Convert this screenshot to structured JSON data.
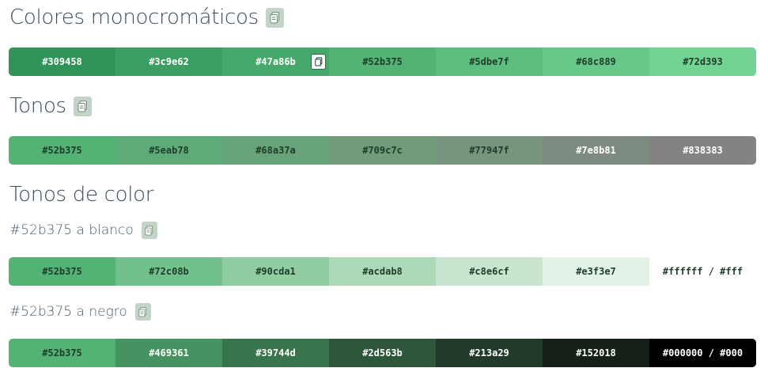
{
  "sections": {
    "mono": {
      "title": "Colores monocromáticos",
      "swatches": [
        {
          "hex": "#309458",
          "label": "#309458",
          "text": "#ffffff"
        },
        {
          "hex": "#3c9e62",
          "label": "#3c9e62",
          "text": "#ffffff"
        },
        {
          "hex": "#47a86b",
          "label": "#47a86b",
          "text": "#ffffff"
        },
        {
          "hex": "#52b375",
          "label": "#52b375",
          "text": "#1e3d2a"
        },
        {
          "hex": "#5dbe7f",
          "label": "#5dbe7f",
          "text": "#1e3d2a"
        },
        {
          "hex": "#68c889",
          "label": "#68c889",
          "text": "#1e3d2a"
        },
        {
          "hex": "#72d393",
          "label": "#72d393",
          "text": "#1e3d2a"
        }
      ]
    },
    "tones": {
      "title": "Tonos",
      "swatches": [
        {
          "hex": "#52b375",
          "label": "#52b375",
          "text": "#1e3d2a"
        },
        {
          "hex": "#5eab78",
          "label": "#5eab78",
          "text": "#1e3d2a"
        },
        {
          "hex": "#68a37a",
          "label": "#68a37a",
          "text": "#1e3d2a"
        },
        {
          "hex": "#709c7c",
          "label": "#709c7c",
          "text": "#1e3d2a"
        },
        {
          "hex": "#77947f",
          "label": "#77947f",
          "text": "#1e3d2a"
        },
        {
          "hex": "#7e8b81",
          "label": "#7e8b81",
          "text": "#ffffff"
        },
        {
          "hex": "#838383",
          "label": "#838383",
          "text": "#ffffff"
        }
      ]
    },
    "shades": {
      "title": "Tonos de color",
      "to_white": {
        "title": "#52b375 a blanco",
        "swatches": [
          {
            "hex": "#52b375",
            "label": "#52b375",
            "text": "#1e3d2a"
          },
          {
            "hex": "#72c08b",
            "label": "#72c08b",
            "text": "#1e3d2a"
          },
          {
            "hex": "#90cda1",
            "label": "#90cda1",
            "text": "#1e3d2a"
          },
          {
            "hex": "#acdab8",
            "label": "#acdab8",
            "text": "#1e3d2a"
          },
          {
            "hex": "#c8e6cf",
            "label": "#c8e6cf",
            "text": "#1e3d2a"
          },
          {
            "hex": "#e3f3e7",
            "label": "#e3f3e7",
            "text": "#1e3d2a"
          },
          {
            "hex": "#ffffff",
            "label": "#ffffff / #fff",
            "text": "#1e3d2a"
          }
        ]
      },
      "to_black": {
        "title": "#52b375 a negro",
        "swatches": [
          {
            "hex": "#52b375",
            "label": "#52b375",
            "text": "#1e3d2a"
          },
          {
            "hex": "#469361",
            "label": "#469361",
            "text": "#ffffff"
          },
          {
            "hex": "#39744d",
            "label": "#39744d",
            "text": "#ffffff"
          },
          {
            "hex": "#2d563b",
            "label": "#2d563b",
            "text": "#ffffff"
          },
          {
            "hex": "#213a29",
            "label": "#213a29",
            "text": "#ffffff"
          },
          {
            "hex": "#152018",
            "label": "#152018",
            "text": "#ffffff"
          },
          {
            "hex": "#000000",
            "label": "#000000 / #000",
            "text": "#ffffff"
          }
        ]
      }
    }
  },
  "hover_copy_index": 2,
  "icons": {
    "copy": "copy-icon"
  },
  "colors": {
    "copy_button_bg": "#c3d3c7",
    "heading_text": "#3b4c57"
  }
}
